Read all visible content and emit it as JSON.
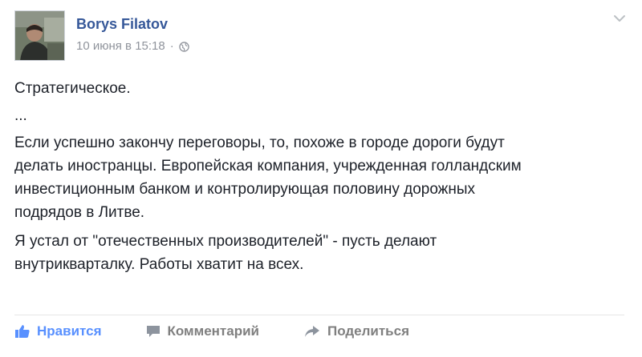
{
  "post": {
    "author": "Borys Filatov",
    "date": "10 июня в 15:18",
    "separator": "·",
    "privacy_icon": "globe-icon",
    "menu_icon": "chevron-down-icon",
    "paragraphs": [
      "Стратегическое.",
      "...",
      "Если успешно закончу переговоры, то, похоже в городе дороги будут\nделать иностранцы. Европейская компания, учрежденная голландским\nинвестиционным банком и контролирующая половину дорожных\nподрядов в Литве.",
      "Я устал от \"отечественных производителей\" - пусть делают\nвнутрикварталку. Работы хватит на всех."
    ]
  },
  "actions": {
    "like_label": "Нравится",
    "comment_label": "Комментарий",
    "share_label": "Поделиться",
    "like_icon": "thumbs-up-icon",
    "comment_icon": "comment-icon",
    "share_icon": "share-arrow-icon"
  },
  "colors": {
    "author": "#365899",
    "like": "#5890ff",
    "muted": "#90949c",
    "action": "#7f7f7f"
  }
}
